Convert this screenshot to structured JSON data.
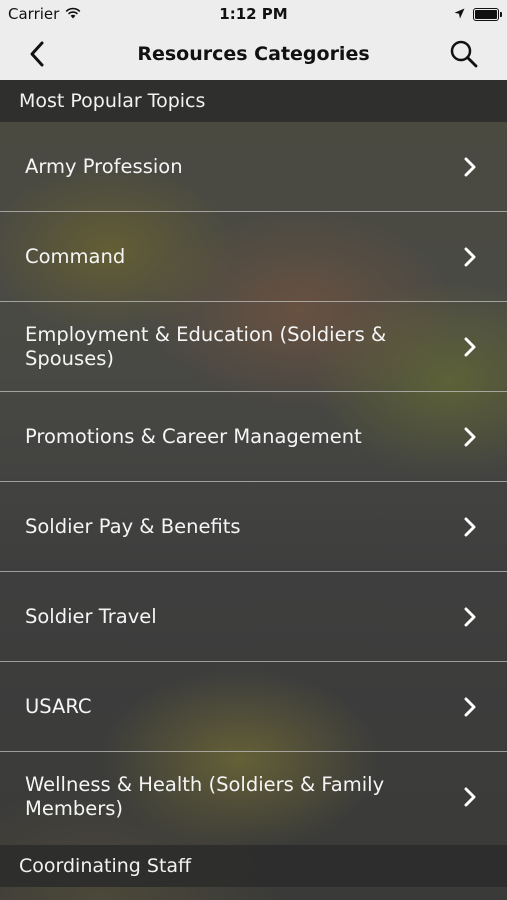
{
  "status_bar": {
    "carrier": "Carrier",
    "time": "1:12 PM"
  },
  "nav": {
    "title": "Resources Categories"
  },
  "sections": [
    {
      "header": "Most Popular Topics",
      "items": [
        {
          "label": "Army Profession"
        },
        {
          "label": "Command"
        },
        {
          "label": "Employment & Education (Soldiers & Spouses)"
        },
        {
          "label": "Promotions & Career Management"
        },
        {
          "label": "Soldier Pay & Benefits"
        },
        {
          "label": "Soldier Travel"
        },
        {
          "label": "USARC"
        },
        {
          "label": "Wellness & Health (Soldiers & Family Members)"
        }
      ]
    },
    {
      "header": "Coordinating Staff",
      "items": []
    }
  ],
  "icons": {
    "back": "chevron-left-icon",
    "search": "search-icon",
    "row_chevron": "chevron-right-icon",
    "wifi": "wifi-icon",
    "location": "location-arrow-icon",
    "battery": "battery-icon"
  },
  "colors": {
    "nav_background": "#ededed",
    "section_header_background": "#2d2d2d",
    "row_text": "#f5f5f5",
    "separator": "#c8c8c8"
  }
}
